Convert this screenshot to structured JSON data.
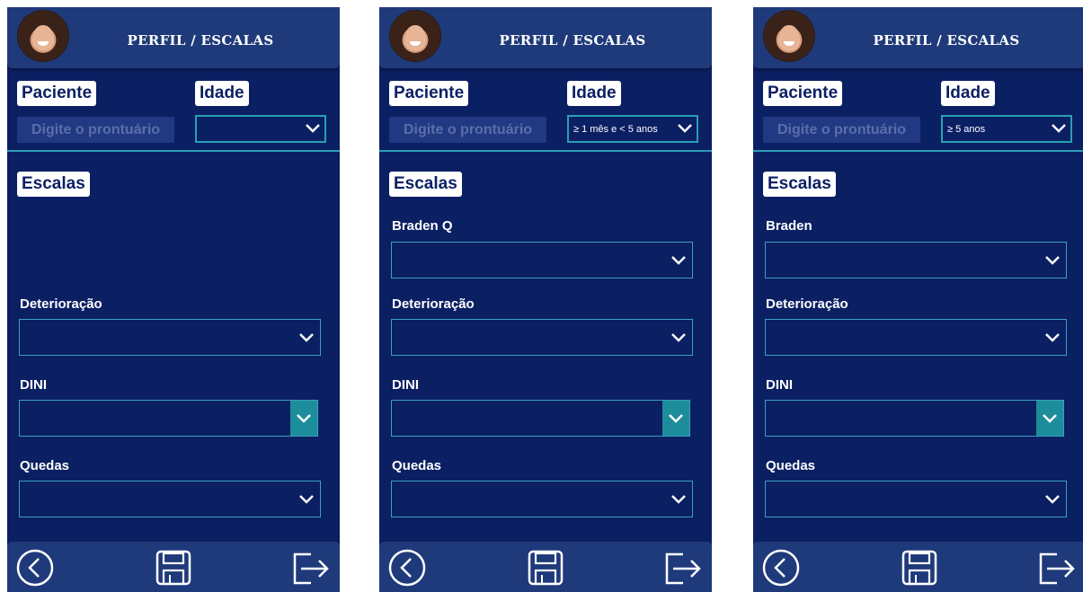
{
  "screens": [
    {
      "header": {
        "title": "PERFIL / ESCALAS"
      },
      "patient": {
        "label": "Paciente",
        "placeholder": "Digite o prontuário"
      },
      "age": {
        "label": "Idade",
        "selected": ""
      },
      "scales": {
        "label": "Escalas",
        "fields": [
          {
            "label": "",
            "value": ""
          },
          {
            "label": "Deterioração",
            "value": ""
          },
          {
            "label": "DINI",
            "value": ""
          },
          {
            "label": "Quedas",
            "value": ""
          }
        ]
      }
    },
    {
      "header": {
        "title": "PERFIL / ESCALAS"
      },
      "patient": {
        "label": "Paciente",
        "placeholder": "Digite o prontuário"
      },
      "age": {
        "label": "Idade",
        "selected": "≥ 1 mês e < 5 anos"
      },
      "scales": {
        "label": "Escalas",
        "fields": [
          {
            "label": "Braden Q",
            "value": ""
          },
          {
            "label": "Deterioração",
            "value": ""
          },
          {
            "label": "DINI",
            "value": ""
          },
          {
            "label": "Quedas",
            "value": ""
          }
        ]
      }
    },
    {
      "header": {
        "title": "PERFIL / ESCALAS"
      },
      "patient": {
        "label": "Paciente",
        "placeholder": "Digite o prontuário"
      },
      "age": {
        "label": "Idade",
        "selected": "≥ 5 anos"
      },
      "scales": {
        "label": "Escalas",
        "fields": [
          {
            "label": "Braden",
            "value": ""
          },
          {
            "label": "Deterioração",
            "value": ""
          },
          {
            "label": "DINI",
            "value": ""
          },
          {
            "label": "Quedas",
            "value": ""
          }
        ]
      }
    }
  ],
  "icons": {
    "back": "back-circle-icon",
    "save": "floppy-disk-icon",
    "exit": "logout-arrow-icon",
    "dropdown": "chevron-down-icon"
  },
  "colors": {
    "background": "#0b1f63",
    "header": "#1f3a7a",
    "accent": "#2d9ab6",
    "dini_chevron_box": "#1e8d9b"
  }
}
